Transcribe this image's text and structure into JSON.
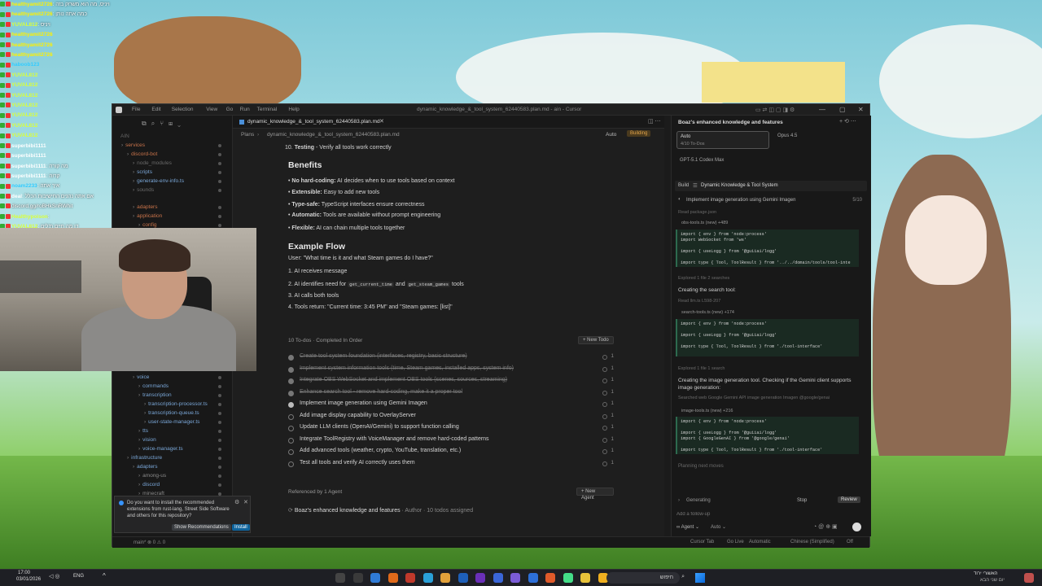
{
  "chat": {
    "lines": [
      {
        "user": "healthyamit2726",
        "cls": "u2",
        "msg": ": ויניס, מה הוא משחק בזה"
      },
      {
        "user": "healthyamit2726",
        "cls": "u2",
        "msg": ": כמה אתה נותן"
      },
      {
        "user": "YUVAL812",
        "cls": "u1",
        "msg": ": ויניס"
      },
      {
        "user": "healthyamit2726",
        "cls": "u2",
        "msg": ""
      },
      {
        "user": "healthyamit2726",
        "cls": "u2",
        "msg": ""
      },
      {
        "user": "healthyamit2726",
        "cls": "u2",
        "msg": ""
      },
      {
        "user": "haboob123",
        "cls": "u3",
        "msg": ""
      },
      {
        "user": "YUVAL812",
        "cls": "u1",
        "msg": ""
      },
      {
        "user": "YUVAL812",
        "cls": "u1",
        "msg": ""
      },
      {
        "user": "YUVAL812",
        "cls": "u1",
        "msg": ""
      },
      {
        "user": "YUVAL812",
        "cls": "u1",
        "msg": ""
      },
      {
        "user": "YUVAL812",
        "cls": "u1",
        "msg": ""
      },
      {
        "user": "YUVAL812",
        "cls": "u1",
        "msg": ""
      },
      {
        "user": "YUVAL812",
        "cls": "u1",
        "msg": ""
      },
      {
        "user": "superbibi1111",
        "cls": "u4",
        "msg": ""
      },
      {
        "user": "superbibi1111",
        "cls": "u4",
        "msg": ""
      },
      {
        "user": "superbibi1111",
        "cls": "u4",
        "msg": ": מה קורה"
      },
      {
        "user": "superbibi1111",
        "cls": "u4",
        "msg": ": קרוה"
      },
      {
        "user": "noam2233",
        "cls": "u3",
        "msg": ": איך אתה"
      },
      {
        "user": "deal",
        "cls": "u4",
        "msg": ": אם אתה נהנים החישיבות הכלל"
      },
      {
        "user": "",
        "cls": "u4",
        "msg": "discord.gg/roBHkSnRWhit"
      },
      {
        "user": "Healthypoison",
        "cls": "u1",
        "msg": ":"
      },
      {
        "user": "YUVAL812",
        "cls": "u1",
        "msg": ": דו מה חיים ת'לים"
      }
    ]
  },
  "window": {
    "title": "dynamic_knowledge_&_tool_system_62440583.plan.md - ain - Cursor",
    "menus": [
      "File",
      "Edit",
      "Selection",
      "View",
      "Go",
      "Run",
      "Terminal",
      "Help"
    ]
  },
  "sidebar": {
    "root": "AIN",
    "items": [
      {
        "label": "services",
        "indent": 1,
        "color": "#c8734a"
      },
      {
        "label": "discord-bot",
        "indent": 2,
        "color": "#c8734a"
      },
      {
        "label": "node_modules",
        "indent": 3,
        "color": "#6a6a6a"
      },
      {
        "label": "scripts",
        "indent": 3,
        "color": "#7aa7d8"
      },
      {
        "label": "generate-env-info.ts",
        "indent": 3,
        "color": "#7aa7d8"
      },
      {
        "label": "sounds",
        "indent": 3,
        "color": "#6a6a6a"
      }
    ],
    "items2": [
      {
        "label": "adapters",
        "indent": 3,
        "color": "#c8734a"
      },
      {
        "label": "application",
        "indent": 3,
        "color": "#c8734a"
      },
      {
        "label": "config",
        "indent": 4,
        "color": "#c8734a"
      }
    ],
    "items3": [
      {
        "label": "voice",
        "indent": 3,
        "color": "#7aa7d8"
      },
      {
        "label": "commands",
        "indent": 4,
        "color": "#7aa7d8"
      },
      {
        "label": "transcription",
        "indent": 4,
        "color": "#7aa7d8"
      },
      {
        "label": "transcription-processor.ts",
        "indent": 5,
        "color": "#7aa7d8"
      },
      {
        "label": "transcription-queue.ts",
        "indent": 5,
        "color": "#7aa7d8"
      },
      {
        "label": "user-state-manager.ts",
        "indent": 5,
        "color": "#7aa7d8"
      },
      {
        "label": "tts",
        "indent": 4,
        "color": "#7aa7d8"
      },
      {
        "label": "vision",
        "indent": 4,
        "color": "#7aa7d8"
      },
      {
        "label": "voice-manager.ts",
        "indent": 4,
        "color": "#7aa7d8"
      },
      {
        "label": "infrastructure",
        "indent": 2,
        "color": "#7aa7d8"
      },
      {
        "label": "adapters",
        "indent": 3,
        "color": "#7aa7d8"
      },
      {
        "label": "among-us",
        "indent": 4,
        "color": "#8a8a8a"
      },
      {
        "label": "discord",
        "indent": 4,
        "color": "#7aa7d8"
      },
      {
        "label": "minecraft",
        "indent": 4,
        "color": "#8a8a8a"
      }
    ]
  },
  "editor": {
    "tab": "dynamic_knowledge_&_tool_system_62440583.plan.md",
    "crumb_plans": "Plans",
    "crumb_file": "dynamic_knowledge_&_tool_system_62440583.plan.md",
    "mode": "Auto",
    "build_btn": "Building",
    "testing_num": "10.",
    "testing_bold": "Testing",
    "testing_rest": " - Verify all tools work correctly",
    "benefits_title": "Benefits",
    "benefits": [
      {
        "bold": "No hard-coding:",
        "rest": " AI decides when to use tools based on context"
      },
      {
        "bold": "Extensible:",
        "rest": " Easy to add new tools"
      },
      {
        "bold": "Type-safe:",
        "rest": " TypeScript interfaces ensure correctness"
      },
      {
        "bold": "Automatic:",
        "rest": " Tools are available without prompt engineering"
      },
      {
        "bold": "Flexible:",
        "rest": " AI can chain multiple tools together"
      }
    ],
    "flow_title": "Example Flow",
    "flow_user": "User: \"What time is it and what Steam games do I have?\"",
    "flow_1": "1. AI receives message",
    "flow_2a": "2. AI identifies need for ",
    "flow_2_code1": "get_current_time",
    "flow_2b": " and ",
    "flow_2_code2": "get_steam_games",
    "flow_2c": " tools",
    "flow_3": "3. AI calls both tools",
    "flow_4": "4. Tools return: \"Current time: 3:45 PM\" and \"Steam games: [list]\"",
    "todos_header": "10 To-dos · Completed In Order",
    "new_todo": "+ New Todo",
    "todos": [
      {
        "text": "Create tool system foundation (interfaces, registry, basic structure)",
        "state": "done",
        "n": "1"
      },
      {
        "text": "Implement system information tools (time, Steam games, installed apps, system info)",
        "state": "done",
        "n": "1"
      },
      {
        "text": "Integrate OBS WebSocket and implement OBS tools (scenes, sources, streaming)",
        "state": "done",
        "n": "1"
      },
      {
        "text": "Enhance search tool - remove hard-coding, make it a proper tool",
        "state": "done",
        "n": "1"
      },
      {
        "text": "Implement image generation using Gemini Imagen",
        "state": "prog",
        "n": "1"
      },
      {
        "text": "Add image display capability to OverlayServer",
        "state": "open",
        "n": "1"
      },
      {
        "text": "Update LLM clients (OpenAI/Gemini) to support function calling",
        "state": "open",
        "n": "1"
      },
      {
        "text": "Integrate ToolRegistry with VoiceManager and remove hard-coded patterns",
        "state": "open",
        "n": "1"
      },
      {
        "text": "Add advanced tools (weather, crypto, YouTube, translation, etc.)",
        "state": "open",
        "n": "1"
      },
      {
        "text": "Test all tools and verify AI correctly uses them",
        "state": "open",
        "n": "1"
      }
    ],
    "ref_header": "Referenced by 1 Agent",
    "new_agent": "+ New Agent",
    "ref_title": "Boaz's enhanced knowledge and features",
    "ref_meta": " · Author · 10 todos assigned"
  },
  "agent": {
    "title": "Boaz's enhanced knowledge and features",
    "model_auto": "Auto",
    "model_auto_sub": "4/10 To-Dos",
    "model_opus": "Opus 4.5",
    "model_gpt": "GPT-5.1 Codex Max",
    "build_label": "Build",
    "plan_name": "Dynamic Knowledge & Tool System",
    "task": "Implement image generation using Gemini Imagen",
    "task_count": "5/10",
    "read1": "Read package.json",
    "file1": "obs-tools.ts (new) +489",
    "code1": [
      "import { env } from 'node:process'",
      "import WebSocket from 'ws'",
      "",
      "import { useLogg } from '@guiiai/logg'",
      "",
      "import type { Tool, ToolResult } from '../../domain/tools/tool-inte"
    ],
    "explored1": "Explored 1 file 2 searches",
    "creating_search": "Creating the search tool:",
    "read2": "Read llm.ts L598-207",
    "file2": "search-tools.ts (new) +174",
    "code2": [
      "import { env } from 'node:process'",
      "",
      "import { useLogg } from '@guiiai/logg'",
      "",
      "import type { Tool, ToolResult } from './tool-interface'"
    ],
    "explored2": "Explored 1 file 1 search",
    "creating_image": "Creating the image generation tool. Checking if the Gemini client supports image generation:",
    "searched": "Searched web Google Gemini API image generation Imagen @google/genai",
    "file3": "image-tools.ts (new) +216",
    "code3": [
      "import { env } from 'node:process'",
      "",
      "import { useLogg } from '@guiiai/logg'",
      "import { GoogleGenAI } from '@google/genai'",
      "",
      "import type { Tool, ToolResult } from './tool-interface'"
    ],
    "planning": "Planning next moves",
    "generating": "Generating",
    "stop": "Stop",
    "review": "Review",
    "placeholder": "Add a follow-up",
    "agent_mode": "Agent",
    "agent_model": "Auto"
  },
  "statusbar": {
    "left": "main* ⊗ 0 ⚠ 0",
    "tab": "Cursor Tab",
    "golive": "Go Live",
    "auto": "Automatic",
    "lang": "Chinese (Simplified)",
    "off": "Off"
  },
  "notification": {
    "text": "Do you want to install the recommended extensions from rust-lang, Street Side Software and others for this repository?",
    "show": "Show Recommendations",
    "install": "Install"
  },
  "taskbar": {
    "time": "17:00",
    "date": "03/01/2026",
    "lang": "ENG",
    "search": "חיפוש",
    "right_text": "האשורי ירוד",
    "right_sub": "יום שני הבא"
  }
}
